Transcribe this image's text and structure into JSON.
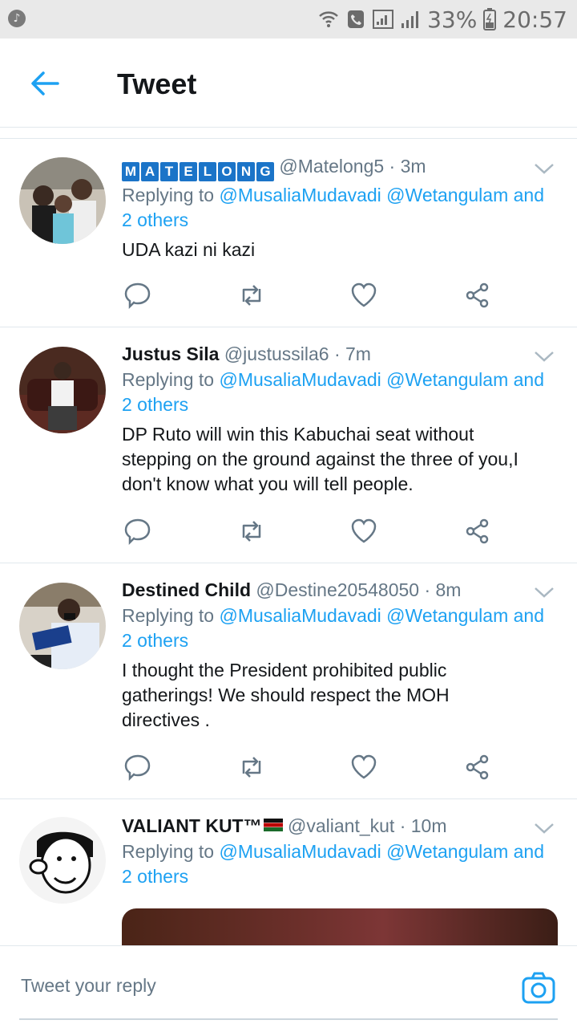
{
  "status_bar": {
    "battery": "33%",
    "time": "20:57"
  },
  "header": {
    "title": "Tweet"
  },
  "tweets": [
    {
      "name": "MATELONG",
      "badge_letters": [
        "M",
        "A",
        "T",
        "E",
        "L",
        "O",
        "N",
        "G"
      ],
      "handle": "@Matelong5",
      "time": "· 3m",
      "replying_prefix": "Replying to",
      "replying_users": "@MusaliaMudavadi @Wetangulam and",
      "replying_others": "2 others",
      "text": "UDA kazi ni kazi"
    },
    {
      "name": "Justus Sila",
      "handle": "@justussila6",
      "time": "· 7m",
      "replying_prefix": "Replying to",
      "replying_users": "@MusaliaMudavadi @Wetangulam and",
      "replying_others": "2 others",
      "text_lines": [
        "DP Ruto will win this Kabuchai seat without",
        "stepping on the ground against the three of you,I",
        "don't know what you will tell people."
      ]
    },
    {
      "name": "Destined Child",
      "handle": "@Destine20548050",
      "time": "· 8m",
      "replying_prefix": "Replying to",
      "replying_users": "@MusaliaMudavadi @Wetangulam and",
      "replying_others": "2 others",
      "text_lines": [
        "I thought the President prohibited public",
        "gatherings! We should respect the MOH",
        "directives ."
      ]
    },
    {
      "name": "VALIANT KUT™",
      "handle": "@valiant_kut",
      "time": "· 10m",
      "replying_prefix": "Replying to",
      "replying_users": "@MusaliaMudavadi @Wetangulam and",
      "replying_others": "2 others"
    }
  ],
  "composer": {
    "placeholder": "Tweet your reply"
  },
  "colors": {
    "accent": "#1da1f2",
    "secondary_text": "#657786",
    "divider": "#e1e8ed"
  }
}
